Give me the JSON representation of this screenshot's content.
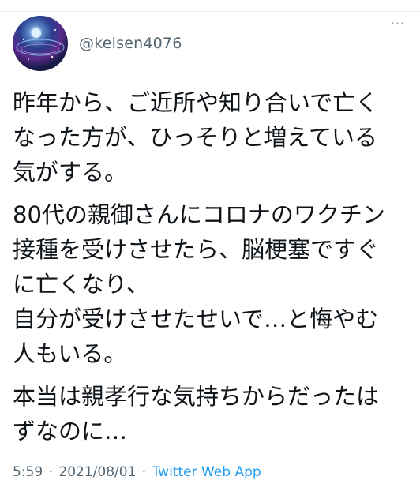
{
  "author": {
    "handle": "@keisen4076",
    "avatar": "avatar"
  },
  "header": {
    "more_icon": "more-horizontal-icon",
    "more_glyph": "···"
  },
  "tweet": {
    "paragraphs": [
      {
        "lines": [
          "昨年から、ご近所や知り合いで亡く",
          "なった方が、ひっそりと増えている",
          "気がする。"
        ]
      },
      {
        "lines": [
          "80代の親御さんにコロナのワクチン",
          "接種を受けさせたら、脳梗塞ですぐ",
          "に亡くなり、",
          "自分が受けさせたせいで…と悔やむ",
          "人もいる。"
        ]
      },
      {
        "lines": [
          "本当は親孝行な気持ちからだったは",
          "ずなのに…"
        ]
      }
    ]
  },
  "meta": {
    "time": "5:59",
    "separator": "·",
    "date": "2021/08/01",
    "app": "Twitter Web App"
  },
  "colors": {
    "text": "#0f1419",
    "secondary": "#536471",
    "link": "#1d9bf0"
  }
}
